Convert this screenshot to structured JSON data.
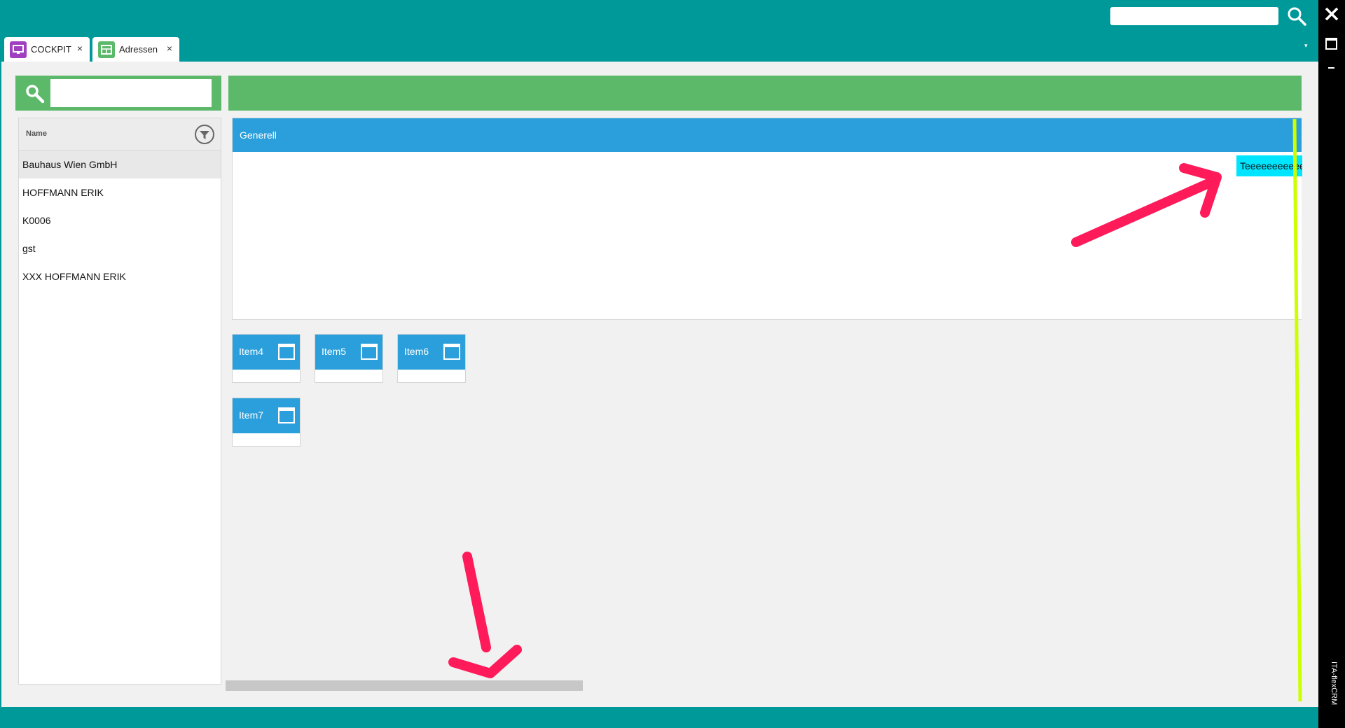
{
  "tabs": [
    {
      "label": "COCKPIT",
      "close": "×",
      "icon": "monitor-icon",
      "icon_color": "#a040c0"
    },
    {
      "label": "Adressen",
      "close": "×",
      "icon": "table-icon",
      "icon_color": "#5cb96a"
    }
  ],
  "global_search": {
    "value": "",
    "placeholder": ""
  },
  "window": {
    "brand": "ITA-flexCRM",
    "minimize": "-"
  },
  "address_search": {
    "value": "",
    "placeholder": ""
  },
  "list": {
    "header": "Name",
    "items": [
      "Bauhaus Wien GmbH",
      "HOFFMANN ERIK",
      "K0006",
      "gst",
      "XXX HOFFMANN ERIK"
    ]
  },
  "card": {
    "title": "Generell",
    "field_value": "Teeeeeeeeeeeeeeeeeeee"
  },
  "tiles": [
    "Item4",
    "Item5",
    "Item6",
    "Item7"
  ],
  "colors": {
    "teal": "#00999a",
    "green": "#5cb96a",
    "blue": "#2a9fdb",
    "cyan": "#00e5ff",
    "annotation_pink": "#ff1a5a",
    "annotation_lime": "#ccff00"
  }
}
